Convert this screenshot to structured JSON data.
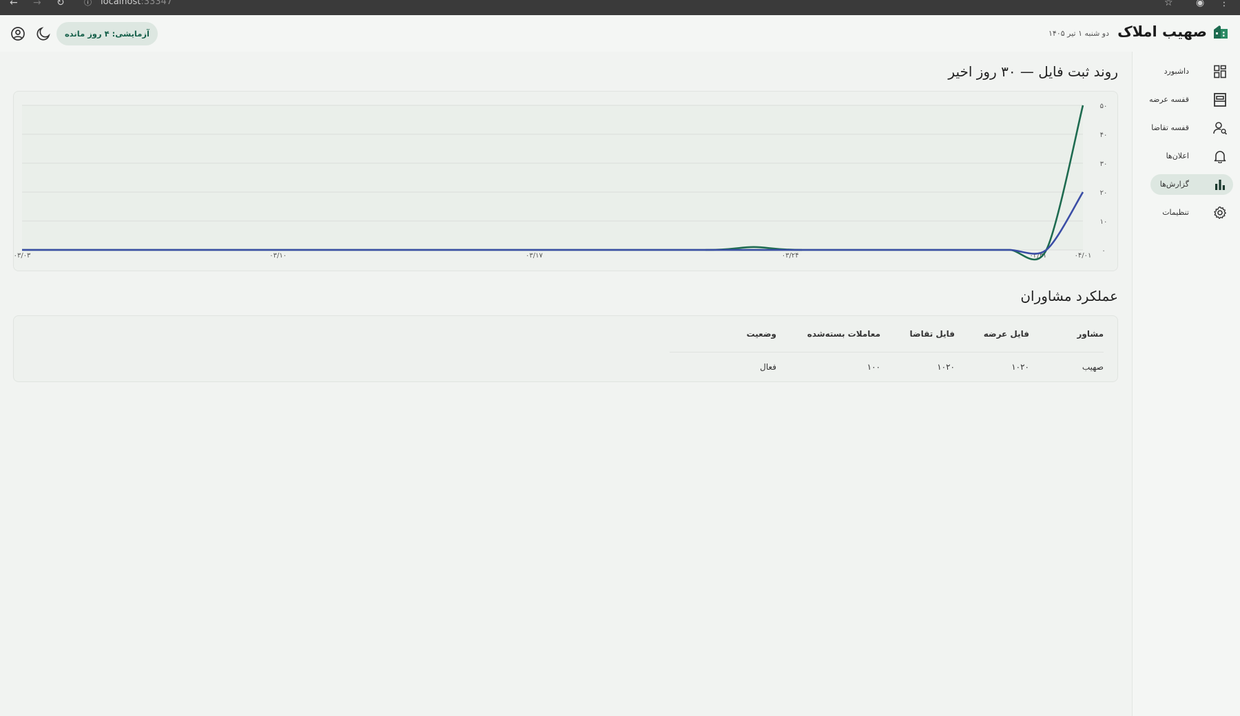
{
  "browser": {
    "url_host": "localhost",
    "url_port": ":33347"
  },
  "header": {
    "app_name": "صهیب املاک",
    "date": "دو شنبه ۱ تیر ۱۴۰۵",
    "trial_badge": "آزمایشی: ۴ روز مانده"
  },
  "sidebar": {
    "items": [
      {
        "label": "داشبورد",
        "icon": "dashboard-icon",
        "active": false
      },
      {
        "label": "قفسه عرضه",
        "icon": "offer-shelf-icon",
        "active": false
      },
      {
        "label": "قفسه تقاضا",
        "icon": "demand-shelf-icon",
        "active": false
      },
      {
        "label": "اعلان‌ها",
        "icon": "bell-icon",
        "active": false
      },
      {
        "label": "گزارش‌ها",
        "icon": "bar-chart-icon",
        "active": true
      },
      {
        "label": "تنظیمات",
        "icon": "gear-icon",
        "active": false
      }
    ]
  },
  "trend": {
    "title": "روند ثبت فایل — ۳۰ روز اخیر"
  },
  "chart_data": {
    "type": "line",
    "x_tick_labels": [
      "۰۳/۰۳",
      "۰۳/۱۰",
      "۰۳/۱۷",
      "۰۳/۲۴",
      "۰۳/۳۱",
      "۰۴/۰۱"
    ],
    "y_tick_labels": [
      "۰",
      "۱۰",
      "۲۰",
      "۳۰",
      "۴۰",
      "۵۰"
    ],
    "ylim": [
      0,
      50
    ],
    "grid": true,
    "points_per_series": 30,
    "series": [
      {
        "color": "#1e6b50",
        "values": [
          0,
          0,
          0,
          0,
          0,
          0,
          0,
          0,
          0,
          0,
          0,
          0,
          0,
          0,
          0,
          0,
          0,
          0,
          0,
          0,
          0,
          0,
          0,
          0,
          0,
          0,
          0,
          0,
          0,
          50
        ],
        "bumps": [
          [
            20,
            1.0
          ]
        ]
      },
      {
        "color": "#3b4ea6",
        "values": [
          0,
          0,
          0,
          0,
          0,
          0,
          0,
          0,
          0,
          0,
          0,
          0,
          0,
          0,
          0,
          0,
          0,
          0,
          0,
          0,
          0,
          0,
          0,
          0,
          0,
          0,
          0,
          0,
          0,
          20
        ],
        "bumps": []
      }
    ]
  },
  "performance": {
    "title": "عملکرد مشاوران",
    "columns": [
      "مشاور",
      "فایل عرضه",
      "فایل تقاضا",
      "معاملات بسته‌شده",
      "وضعیت"
    ],
    "rows": [
      [
        "صهیب",
        "۱۰۲۰",
        "۱۰۲۰",
        "۱۰۰",
        "فعال"
      ]
    ]
  },
  "colors": {
    "accent": "#1e6b50",
    "secondary": "#3b4ea6",
    "active_bg": "#dde7e1"
  }
}
